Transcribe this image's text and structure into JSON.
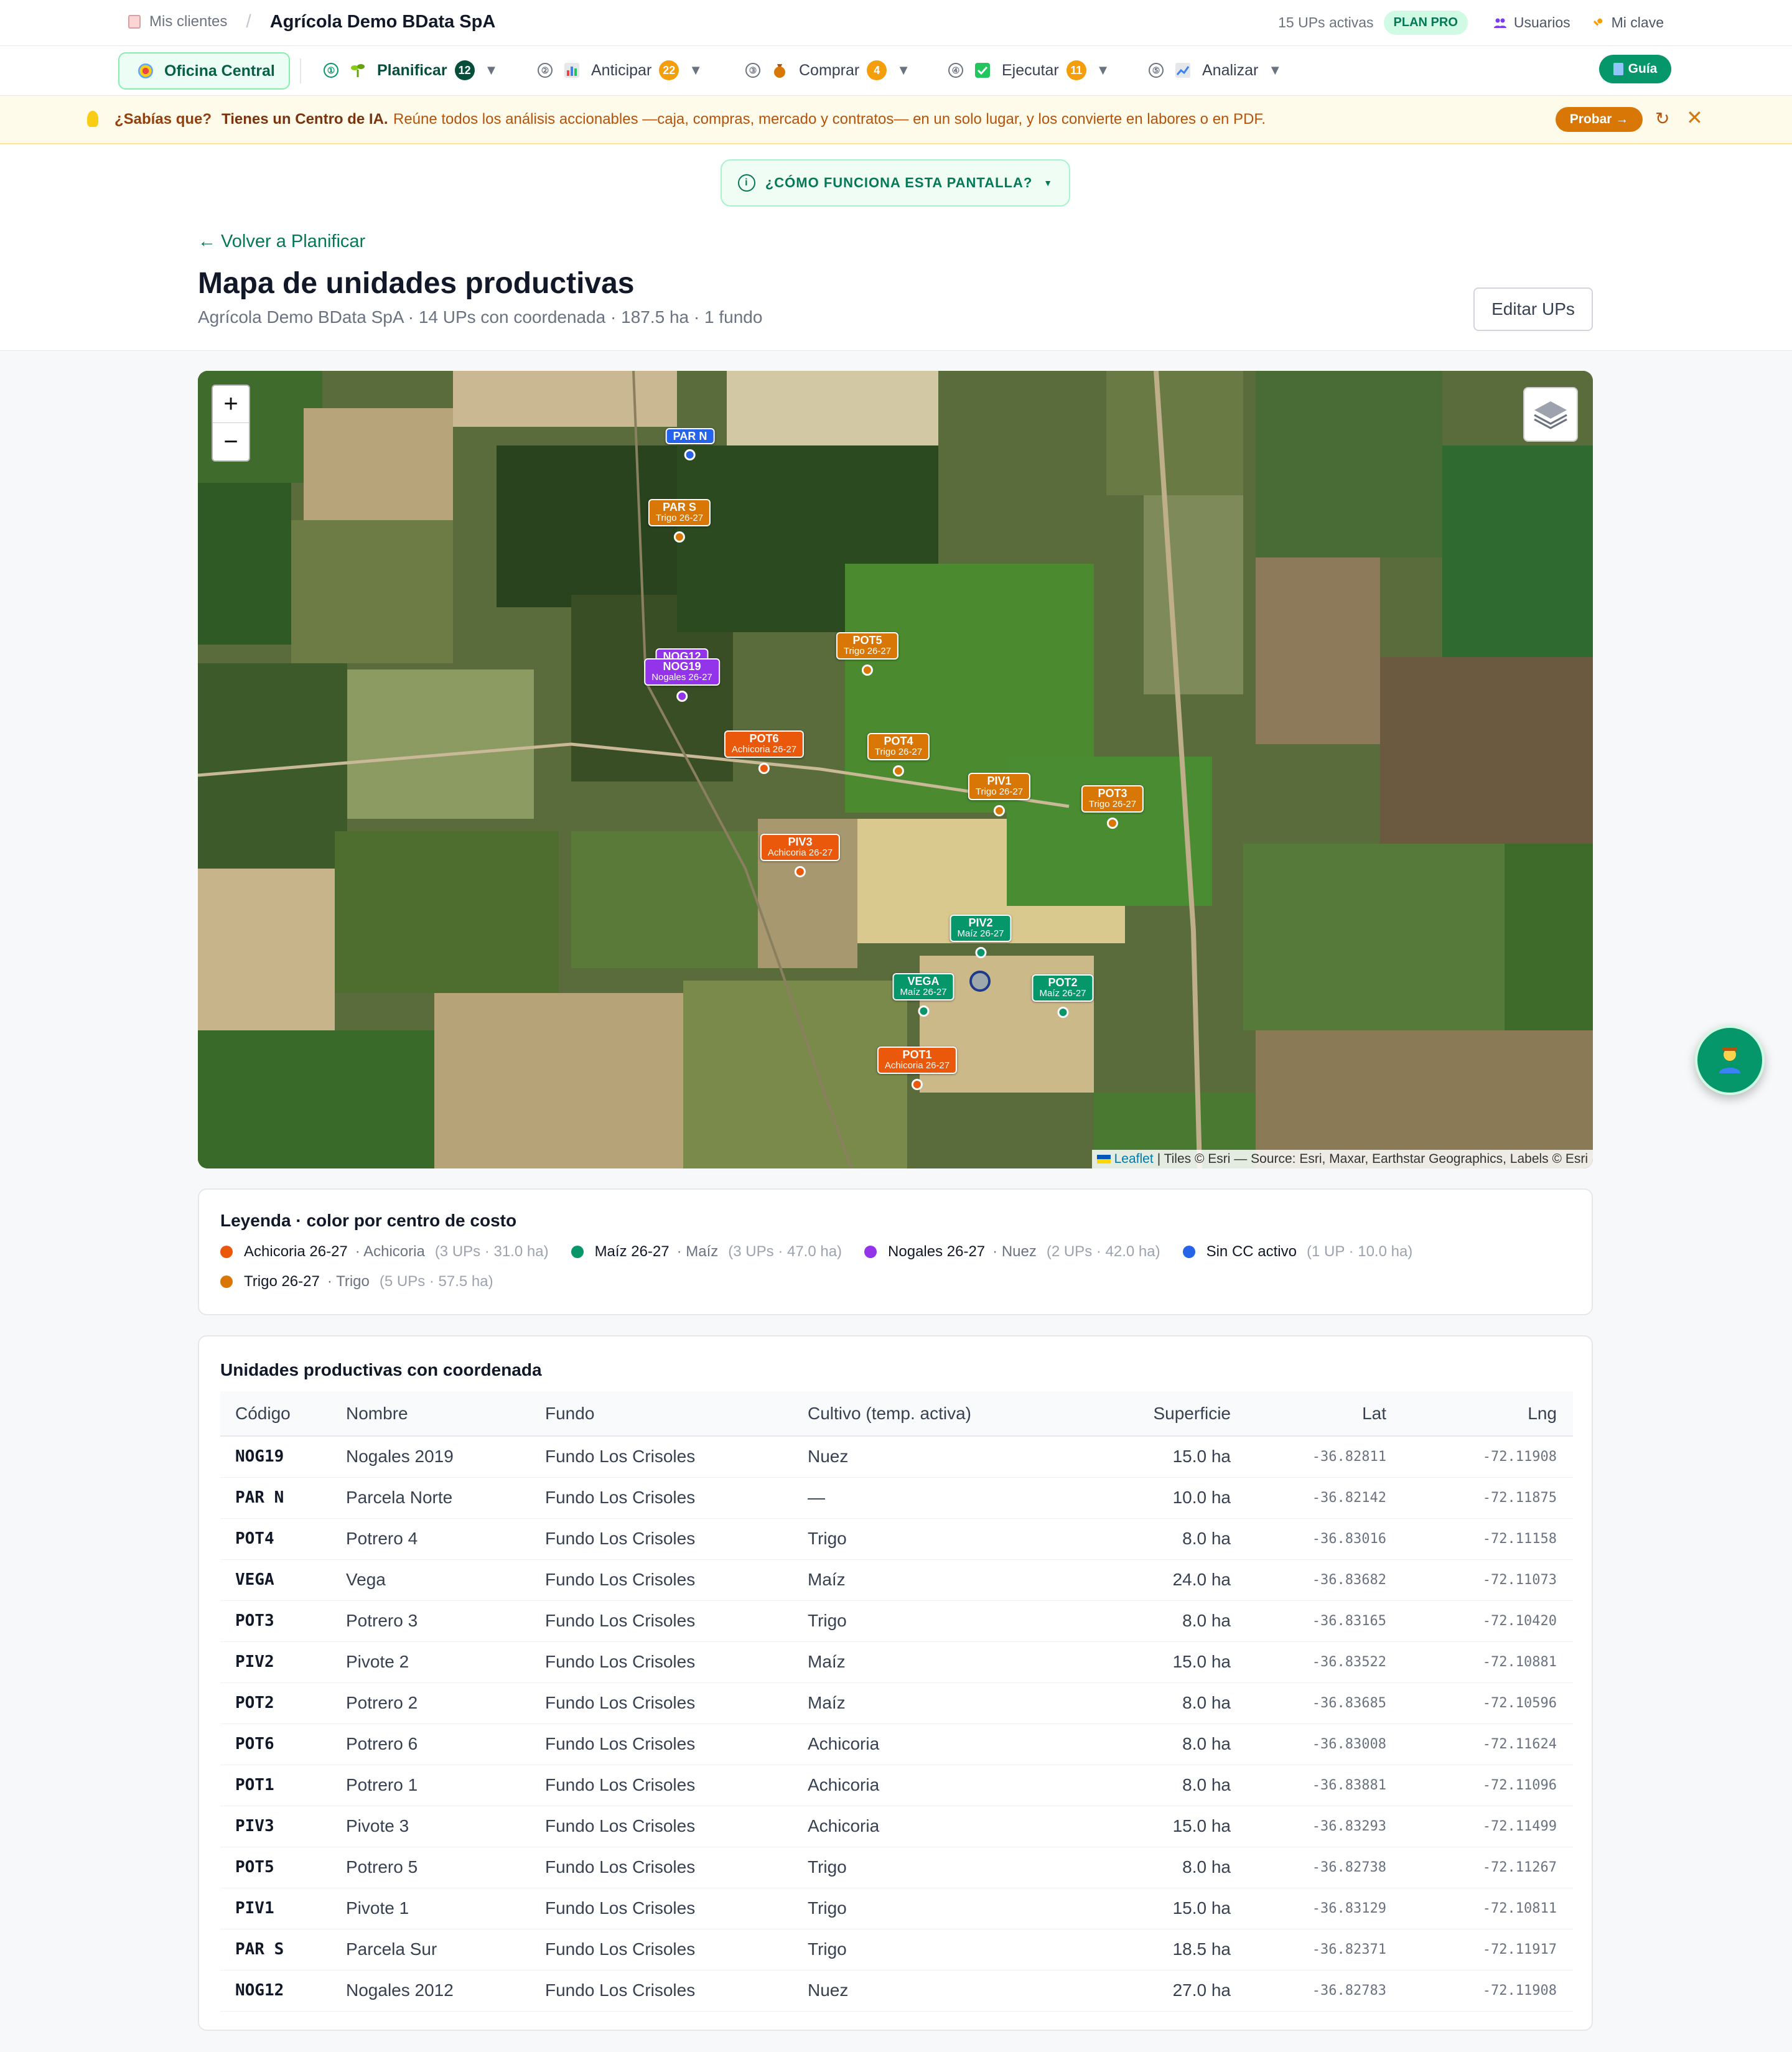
{
  "topbar": {
    "breadcrumb": "Mis clientes",
    "client": "Agrícola Demo BData SpA",
    "ups_active": "15 UPs activas",
    "plan": "PLAN PRO",
    "users": "Usuarios",
    "key": "Mi clave"
  },
  "nav": {
    "office": "Oficina Central",
    "items": [
      {
        "label": "Planificar",
        "count": "12",
        "color": "#064e3b"
      },
      {
        "label": "Anticipar",
        "count": "22",
        "color": "#f59e0b"
      },
      {
        "label": "Comprar",
        "count": "4",
        "color": "#f59e0b"
      },
      {
        "label": "Ejecutar",
        "count": "11",
        "color": "#f59e0b"
      },
      {
        "label": "Analizar",
        "count": ""
      }
    ],
    "guide": "Guía"
  },
  "tip": {
    "question": "¿Sabías que?",
    "headline": "Tienes un Centro de IA.",
    "text": "Reúne todos los análisis accionables —caja, compras, mercado y contratos— en un solo lugar, y los convierte en labores o en PDF.",
    "cta": "Probar →"
  },
  "header": {
    "how": "¿CÓMO FUNCIONA ESTA PANTALLA?",
    "back": "← Volver a Planificar",
    "title": "Mapa de unidades productivas",
    "subtitle": "Agrícola Demo BData SpA · 14 UPs con coordenada · 187.5 ha · 1 fundo",
    "edit": "Editar UPs"
  },
  "map": {
    "attribution_link": "Leaflet",
    "attribution": "| Tiles © Esri — Source: Esri, Maxar, Earthstar Geographics, Labels © Esri",
    "markers": [
      {
        "code": "PAR N",
        "sub": "",
        "color": "#2563eb"
      },
      {
        "code": "PAR S",
        "sub": "Trigo 26-27",
        "color": "#d97706"
      },
      {
        "code": "POT5",
        "sub": "Trigo 26-27",
        "color": "#d97706"
      },
      {
        "code": "NOG12",
        "sub": "",
        "color": "#9333ea"
      },
      {
        "code": "NOG19",
        "sub": "Nogales 26-27",
        "color": "#9333ea"
      },
      {
        "code": "POT6",
        "sub": "Achicoria 26-27",
        "color": "#ea580c"
      },
      {
        "code": "POT4",
        "sub": "Trigo 26-27",
        "color": "#d97706"
      },
      {
        "code": "PIV1",
        "sub": "Trigo 26-27",
        "color": "#d97706"
      },
      {
        "code": "POT3",
        "sub": "Trigo 26-27",
        "color": "#d97706"
      },
      {
        "code": "PIV3",
        "sub": "Achicoria 26-27",
        "color": "#ea580c"
      },
      {
        "code": "PIV2",
        "sub": "Maíz 26-27",
        "color": "#059669"
      },
      {
        "code": "VEGA",
        "sub": "Maíz 26-27",
        "color": "#059669"
      },
      {
        "code": "POT2",
        "sub": "Maíz 26-27",
        "color": "#059669"
      },
      {
        "code": "POT1",
        "sub": "Achicoria 26-27",
        "color": "#ea580c"
      }
    ]
  },
  "legend": {
    "title": "Leyenda · color por centro de costo",
    "items": [
      {
        "name": "Achicoria 26-27",
        "crop": "· Achicoria",
        "stats": "(3 UPs · 31.0 ha)",
        "color": "#ea580c"
      },
      {
        "name": "Maíz 26-27",
        "crop": "· Maíz",
        "stats": "(3 UPs · 47.0 ha)",
        "color": "#059669"
      },
      {
        "name": "Nogales 26-27",
        "crop": "· Nuez",
        "stats": "(2 UPs · 42.0 ha)",
        "color": "#9333ea"
      },
      {
        "name": "Sin CC activo",
        "crop": "",
        "stats": "(1 UP · 10.0 ha)",
        "color": "#2563eb"
      },
      {
        "name": "Trigo 26-27",
        "crop": "· Trigo",
        "stats": "(5 UPs · 57.5 ha)",
        "color": "#d97706"
      }
    ]
  },
  "table": {
    "title": "Unidades productivas con coordenada",
    "columns": [
      "Código",
      "Nombre",
      "Fundo",
      "Cultivo (temp. activa)",
      "Superficie",
      "Lat",
      "Lng"
    ],
    "rows": [
      [
        "NOG19",
        "Nogales 2019",
        "Fundo Los Crisoles",
        "Nuez",
        "15.0 ha",
        "-36.82811",
        "-72.11908"
      ],
      [
        "PAR N",
        "Parcela Norte",
        "Fundo Los Crisoles",
        "—",
        "10.0 ha",
        "-36.82142",
        "-72.11875"
      ],
      [
        "POT4",
        "Potrero 4",
        "Fundo Los Crisoles",
        "Trigo",
        "8.0 ha",
        "-36.83016",
        "-72.11158"
      ],
      [
        "VEGA",
        "Vega",
        "Fundo Los Crisoles",
        "Maíz",
        "24.0 ha",
        "-36.83682",
        "-72.11073"
      ],
      [
        "POT3",
        "Potrero 3",
        "Fundo Los Crisoles",
        "Trigo",
        "8.0 ha",
        "-36.83165",
        "-72.10420"
      ],
      [
        "PIV2",
        "Pivote 2",
        "Fundo Los Crisoles",
        "Maíz",
        "15.0 ha",
        "-36.83522",
        "-72.10881"
      ],
      [
        "POT2",
        "Potrero 2",
        "Fundo Los Crisoles",
        "Maíz",
        "8.0 ha",
        "-36.83685",
        "-72.10596"
      ],
      [
        "POT6",
        "Potrero 6",
        "Fundo Los Crisoles",
        "Achicoria",
        "8.0 ha",
        "-36.83008",
        "-72.11624"
      ],
      [
        "POT1",
        "Potrero 1",
        "Fundo Los Crisoles",
        "Achicoria",
        "8.0 ha",
        "-36.83881",
        "-72.11096"
      ],
      [
        "PIV3",
        "Pivote 3",
        "Fundo Los Crisoles",
        "Achicoria",
        "15.0 ha",
        "-36.83293",
        "-72.11499"
      ],
      [
        "POT5",
        "Potrero 5",
        "Fundo Los Crisoles",
        "Trigo",
        "8.0 ha",
        "-36.82738",
        "-72.11267"
      ],
      [
        "PIV1",
        "Pivote 1",
        "Fundo Los Crisoles",
        "Trigo",
        "15.0 ha",
        "-36.83129",
        "-72.10811"
      ],
      [
        "PAR S",
        "Parcela Sur",
        "Fundo Los Crisoles",
        "Trigo",
        "18.5 ha",
        "-36.82371",
        "-72.11917"
      ],
      [
        "NOG12",
        "Nogales 2012",
        "Fundo Los Crisoles",
        "Nuez",
        "27.0 ha",
        "-36.82783",
        "-72.11908"
      ]
    ]
  }
}
